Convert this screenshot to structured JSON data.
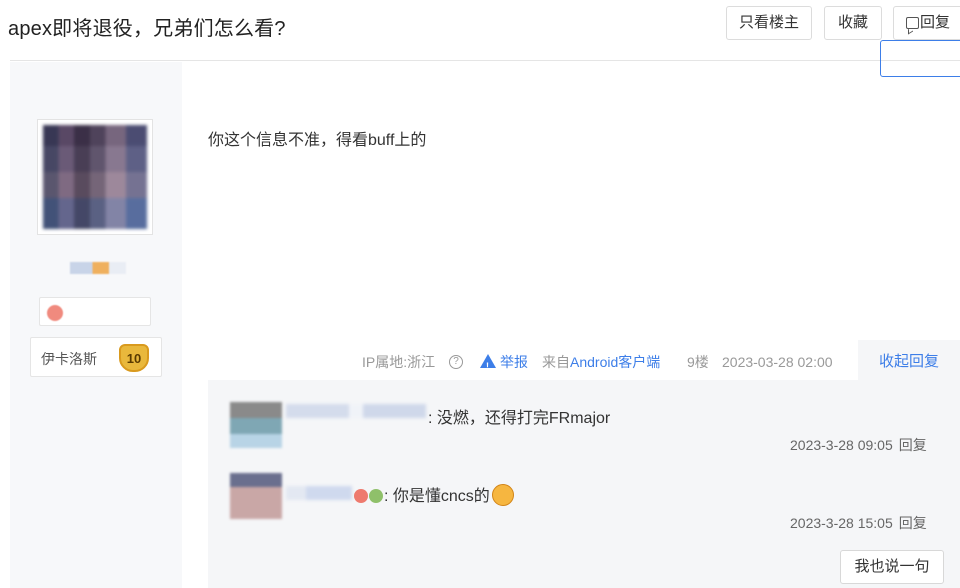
{
  "header": {
    "title": "apex即将退役，兄弟们怎么看?",
    "only_op_label": "只看楼主",
    "favorite_label": "收藏",
    "reply_label": "回复"
  },
  "post": {
    "content": "你这个信息不准，得看buff上的",
    "author_badge": {
      "name": "伊卡洛斯",
      "level": "10"
    },
    "ip_location": "IP属地:浙江",
    "report_label": "举报",
    "source_prefix": "来自",
    "source_app": "Android客户端",
    "floor": "9楼",
    "time": "2023-03-28 02:00",
    "collapse_label": "收起回复"
  },
  "replies": [
    {
      "text": ": 没燃，还得打完FRmajor",
      "time": "2023-3-28 09:05",
      "reply_label": "回复"
    },
    {
      "text": ": 你是懂cncs的",
      "time": "2023-3-28 15:05",
      "reply_label": "回复"
    }
  ],
  "say_something_label": "我也说一句",
  "colors": {
    "accent": "#3d7ee8",
    "sidebar_bg": "#f7f8fa",
    "reply_bg": "#f5f6f8"
  }
}
